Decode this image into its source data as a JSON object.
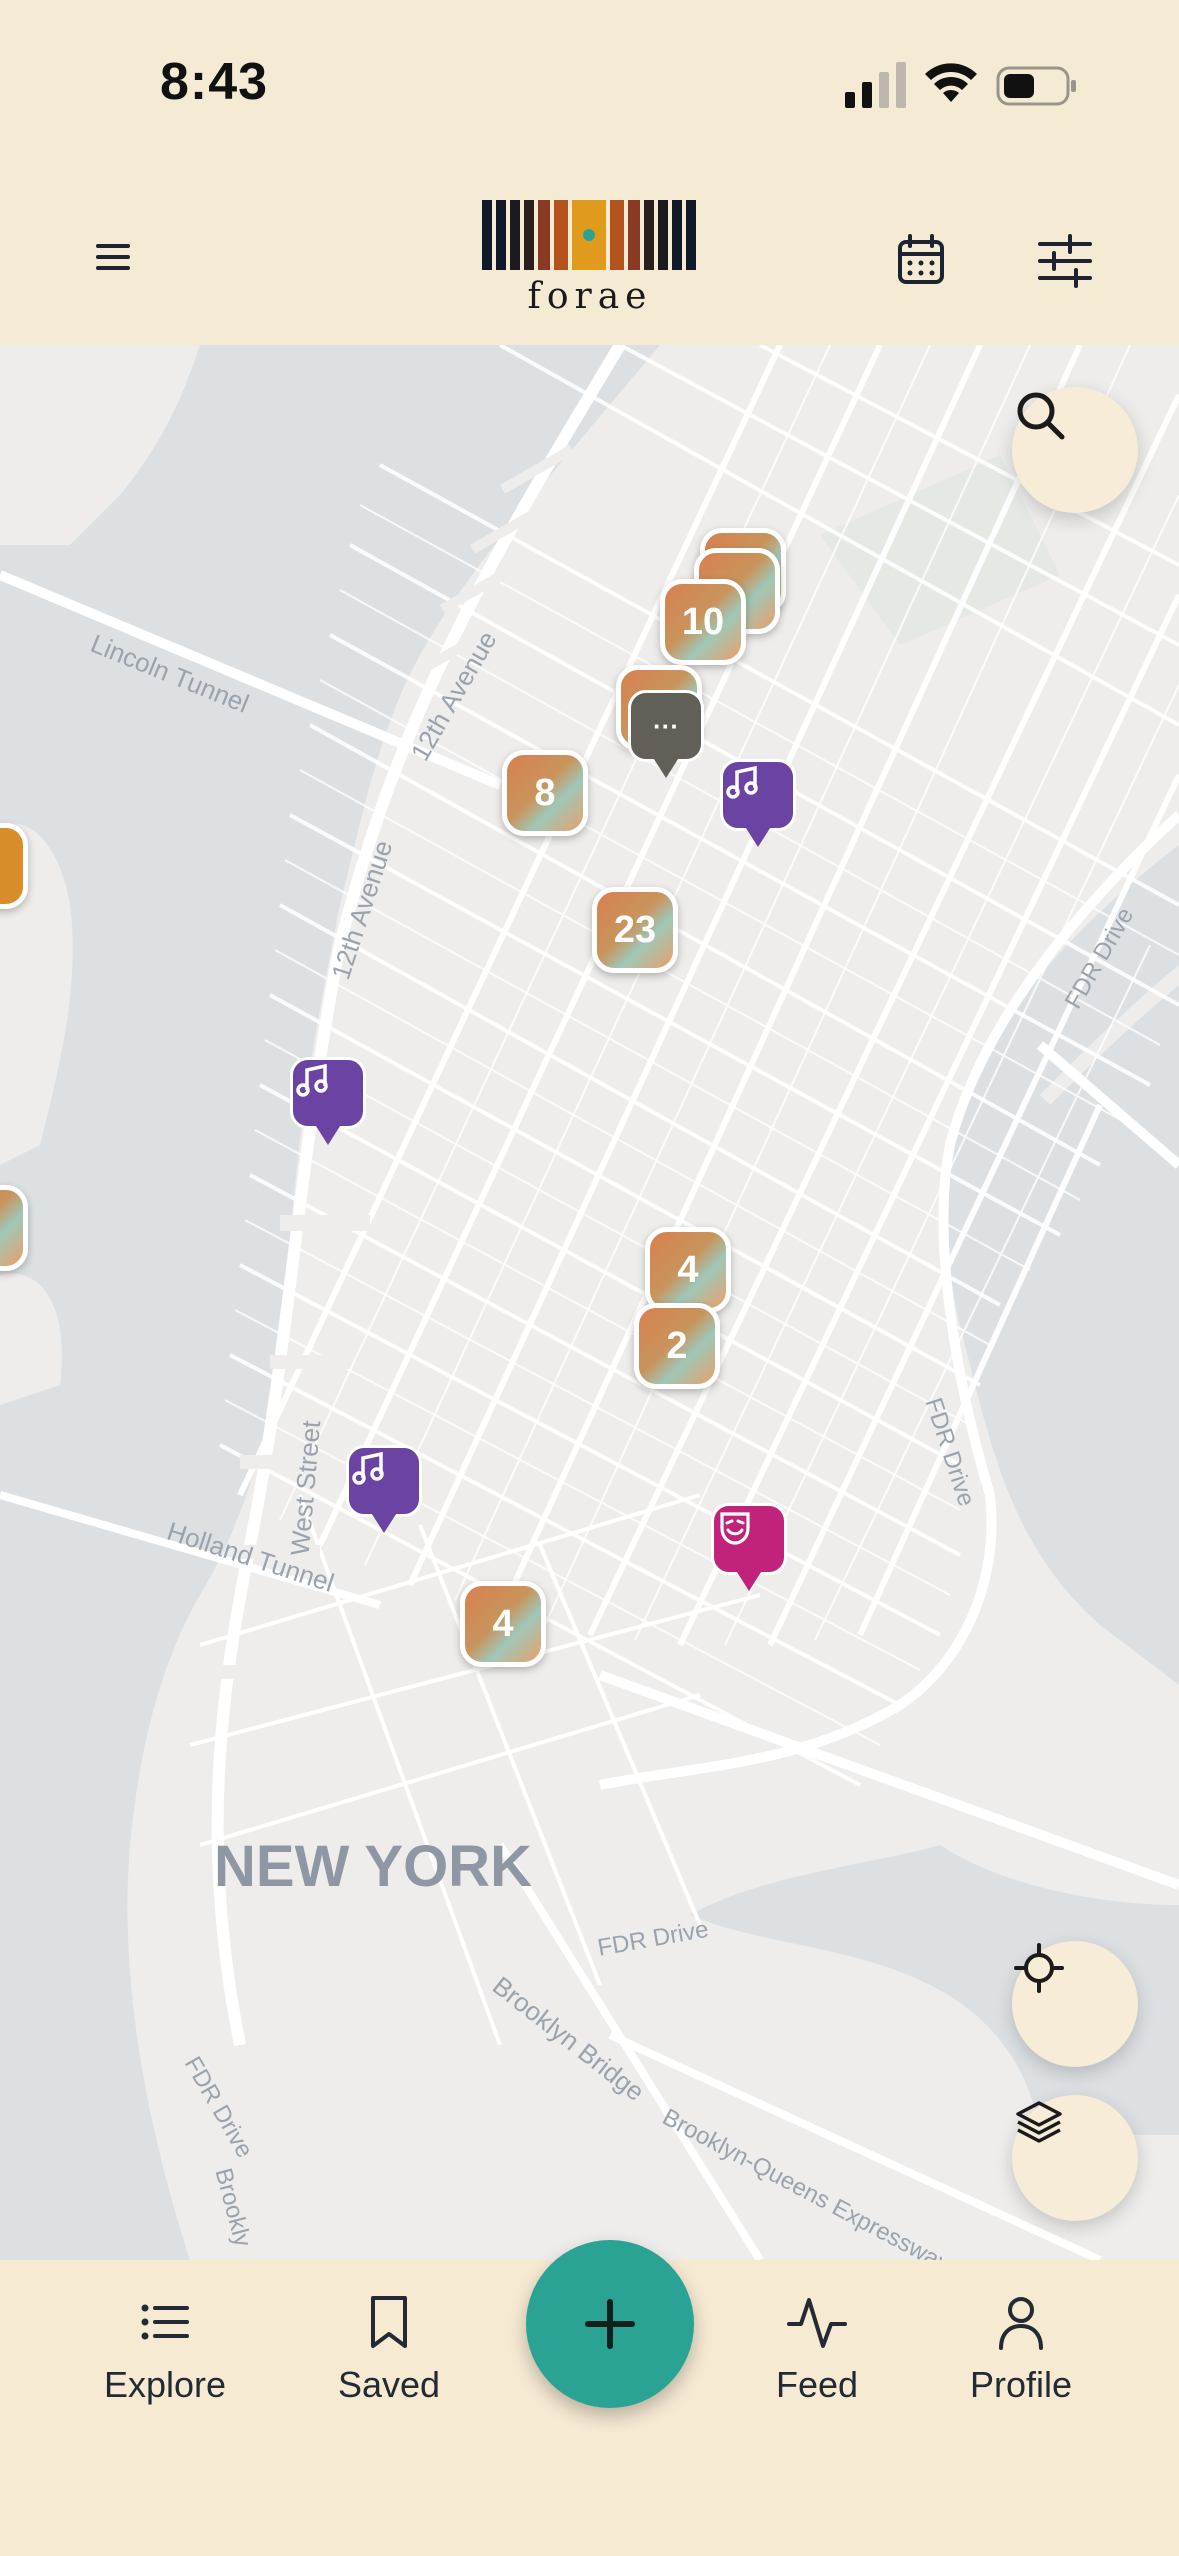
{
  "status_bar": {
    "time": "8:43"
  },
  "header": {
    "logo_text": "forae"
  },
  "map": {
    "labels": {
      "new_york": "NEW YORK",
      "lincoln_tunnel": "Lincoln Tunnel",
      "holland_tunnel": "Holland Tunnel",
      "twelfth_ave_a": "12th Avenue",
      "twelfth_ave_b": "12th Avenue",
      "west_street": "West Street",
      "fdr_drive_a": "FDR Drive",
      "fdr_drive_b": "FDR Drive",
      "fdr_drive_c": "FDR Drive",
      "fdr_drive_d": "FDR Drive",
      "brooklyn_bridge": "Brooklyn Bridge",
      "bqe": "Brooklyn-Queens Expressway",
      "brooklyn": "Brookly"
    },
    "clusters": [
      {
        "count": "10"
      },
      {
        "count": "8"
      },
      {
        "count": "23"
      },
      {
        "count": "4"
      },
      {
        "count": "2"
      },
      {
        "count": "4"
      }
    ],
    "more_marker": "···",
    "colors": {
      "music": "#6b44a3",
      "theater": "#c2237a",
      "more": "#625e58"
    }
  },
  "nav": {
    "explore": "Explore",
    "saved": "Saved",
    "feed": "Feed",
    "profile": "Profile"
  },
  "accent_color": "#2aa294"
}
